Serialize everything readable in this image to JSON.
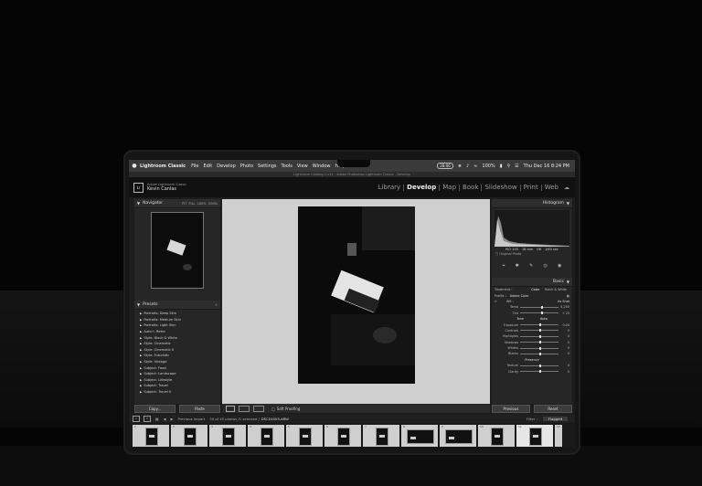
{
  "menubar": {
    "app": "Lightroom Classic",
    "items": [
      "File",
      "Edit",
      "Develop",
      "Photo",
      "Settings",
      "Tools",
      "View",
      "Window",
      "Help"
    ],
    "status_pill": "28:06",
    "battery": "100%",
    "datetime": "Thu Dec 16  8:24 PM"
  },
  "window_title": "Lightroom Catalog-2-v12 - Adobe Photoshop Lightroom Classic - Develop",
  "identity": {
    "product": "Adobe Lightroom Classic",
    "user": "Kevin Canlas"
  },
  "modules": [
    "Library",
    "Develop",
    "Map",
    "Book",
    "Slideshow",
    "Print",
    "Web"
  ],
  "active_module": "Develop",
  "navigator": {
    "title": "Navigator",
    "zoom": [
      "FIT",
      "FILL",
      "100%",
      "200%"
    ]
  },
  "presets": {
    "title": "Presets",
    "items": [
      "Portraits: Deep Skin",
      "Portraits: Medium Skin",
      "Portraits: Light Skin",
      "Auto+: Retro",
      "Style: Black & White",
      "Style: Cinematic",
      "Style: Cinematic II",
      "Style: Futuristic",
      "Style: Vintage",
      "Subject: Food",
      "Subject: Landscape",
      "Subject: Lifestyle",
      "Subject: Travel",
      "Subject: Travel II"
    ]
  },
  "left_buttons": {
    "copy": "Copy...",
    "paste": "Paste"
  },
  "toolbar": {
    "soft_proofing": "Soft Proofing"
  },
  "histogram": {
    "title": "Histogram",
    "values": [
      "ISO 100",
      "16 mm",
      "f/8",
      "1/60 sec"
    ],
    "original_photo": "Original Photo"
  },
  "basic": {
    "title": "Basic",
    "treatment_label": "Treatment :",
    "treatment_options": [
      "Color",
      "Black & White"
    ],
    "profile_label": "Profile :",
    "profile_value": "Adobe Color",
    "wb_label": "WB :",
    "wb_value": "As Shot",
    "temp_label": "Temp",
    "temp_value": "5,250",
    "tint_label": "Tint",
    "tint_value": "+ 20",
    "tone_label": "Tone",
    "tone_auto": "Auto",
    "sliders": [
      {
        "label": "Exposure",
        "value": "0.00"
      },
      {
        "label": "Contrast",
        "value": "0"
      },
      {
        "label": "Highlights",
        "value": "0"
      },
      {
        "label": "Shadows",
        "value": "0"
      },
      {
        "label": "Whites",
        "value": "0"
      },
      {
        "label": "Blacks",
        "value": "0"
      }
    ],
    "presence_label": "Presence",
    "presence_sliders": [
      {
        "label": "Texture",
        "value": "0"
      },
      {
        "label": "Clarity",
        "value": "0"
      }
    ]
  },
  "right_buttons": {
    "previous": "Previous",
    "reset": "Reset"
  },
  "filmstrip_bar": {
    "source": "Previous Import",
    "count": "30 of 45 photos /1 selected /",
    "filename": "DSC04005.ARW",
    "filter_label": "Filter :",
    "filter_value": "Flagged"
  },
  "filmstrip": {
    "numbers": [
      "1",
      "2",
      "3",
      "4",
      "5",
      "6",
      "7",
      "8",
      "9",
      "10",
      "11",
      "12"
    ]
  },
  "colors": {
    "panel": "#262626",
    "canvas": "#d0d0d0",
    "background": "#050505"
  }
}
